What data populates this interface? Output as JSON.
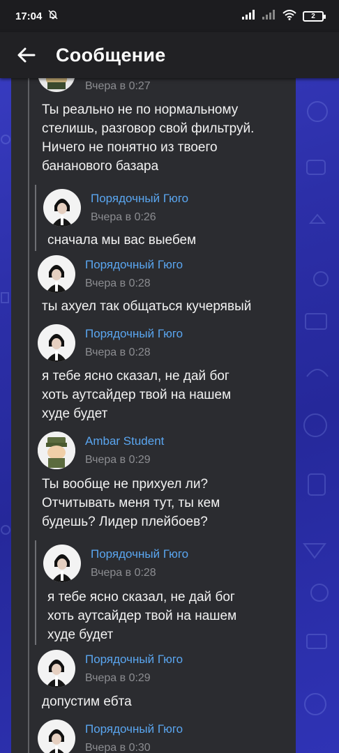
{
  "status_bar": {
    "time": "17:04",
    "battery": "2"
  },
  "app_bar": {
    "title": "Сообщение"
  },
  "messages": [
    {
      "author": "",
      "date": "Вчера в 0:27",
      "avatar": "student",
      "lines": [
        "Ты реально не по нормальному",
        "стелишь, разговор свой фильтруй.",
        "Ничего не понятно из твоего",
        "бананового базара"
      ]
    },
    {
      "author": "Порядочный Гюго",
      "date": "Вчера в 0:26",
      "avatar": "hugo",
      "lines": [
        "сначала мы вас выебем"
      ]
    },
    {
      "author": "Порядочный Гюго",
      "date": "Вчера в 0:28",
      "avatar": "hugo",
      "lines": [
        "ты ахуел так общаться кучерявый"
      ]
    },
    {
      "author": "Порядочный Гюго",
      "date": "Вчера в 0:28",
      "avatar": "hugo",
      "lines": [
        "я тебе ясно сказал, не дай бог",
        "хоть аутсайдер твой на нашем",
        "худе будет"
      ]
    },
    {
      "author": "Ambar Student",
      "date": "Вчера в 0:29",
      "avatar": "student",
      "lines": [
        "Ты вообще не прихуел ли?",
        "Отчитывать меня тут, ты кем",
        "будешь? Лидер плейбоев?"
      ]
    },
    {
      "author": "Порядочный Гюго",
      "date": "Вчера в 0:28",
      "avatar": "hugo",
      "lines": [
        "я тебе ясно сказал, не дай бог",
        "хоть аутсайдер твой на нашем",
        "худе будет"
      ]
    },
    {
      "author": "Порядочный Гюго",
      "date": "Вчера в 0:29",
      "avatar": "hugo",
      "lines": [
        "допустим ебта"
      ]
    },
    {
      "author": "Порядочный Гюго",
      "date": "Вчера в 0:30",
      "avatar": "hugo",
      "lines": []
    }
  ],
  "colors": {
    "author": "#5aa6f0",
    "date": "#8c8d91",
    "text": "#f2f2f2",
    "panel": "#2b2c30"
  },
  "icons": {
    "back": "arrow-left-icon",
    "mute": "bell-off-icon",
    "signal": "signal-icon",
    "wifi": "wifi-icon",
    "battery": "battery-icon"
  }
}
